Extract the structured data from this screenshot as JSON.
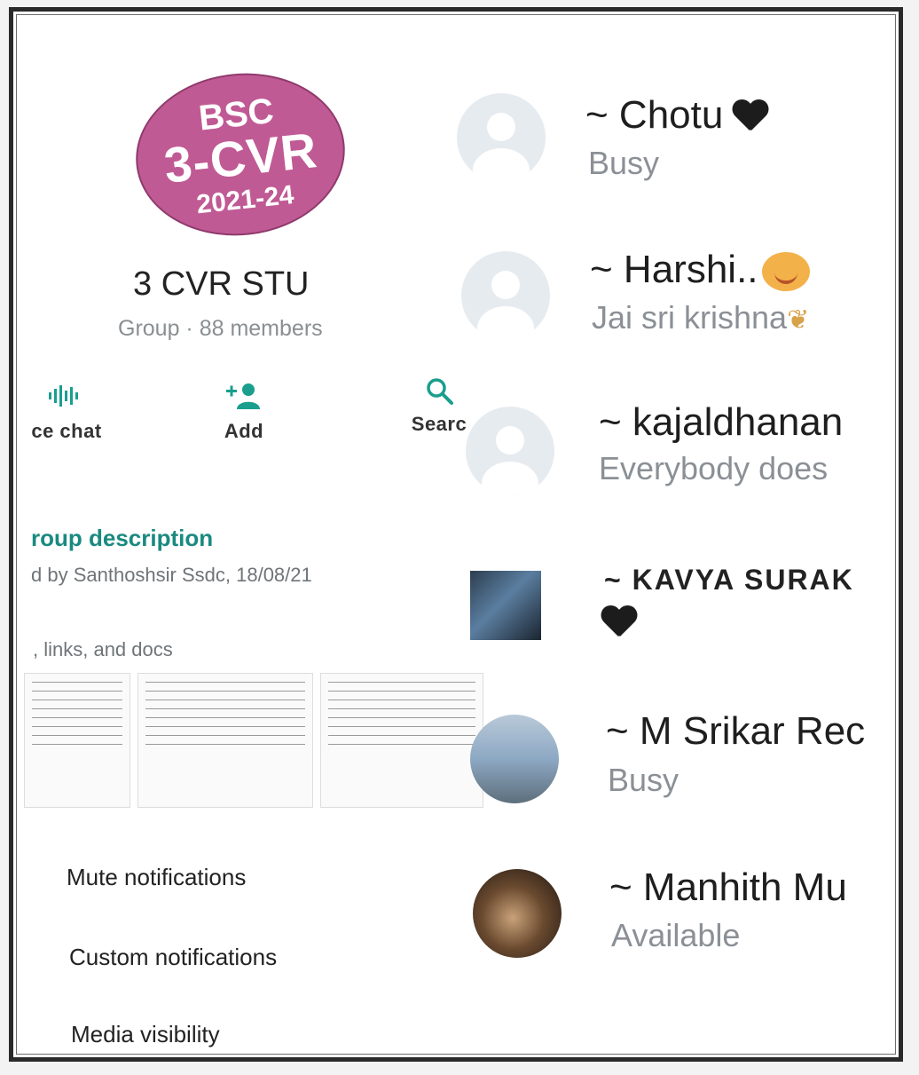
{
  "group": {
    "logo": {
      "line1": "BSC",
      "line2": "3-CVR",
      "line3": "2021-24",
      "color": "#c05a94"
    },
    "name": "3 CVR STU",
    "meta": "Group · 88 members"
  },
  "actions": [
    {
      "label": "ce chat",
      "icon": "voice-chat-icon"
    },
    {
      "label": "Add",
      "icon": "add-person-icon"
    },
    {
      "label": "Searc",
      "icon": "search-icon"
    }
  ],
  "description": {
    "title": "roup description",
    "created_by": "d by Santhoshsir Ssdc, 18/08/21"
  },
  "media": {
    "title": ", links, and docs"
  },
  "settings": [
    {
      "label": "Mute notifications"
    },
    {
      "label": "Custom notifications"
    },
    {
      "label": "Media visibility"
    }
  ],
  "members": [
    {
      "name": "~ Chotu",
      "status": "Busy",
      "emoji": "black-heart-icon"
    },
    {
      "name": "~ Harshi..",
      "status": "Jai sri krishna",
      "emoji": "smiling-face-icon",
      "status_emoji": "folded-hands-icon"
    },
    {
      "name": "~ kajaldhanan",
      "status": "Everybody does"
    },
    {
      "name": "~ KAVYA SURAK",
      "status_emoji": "black-heart-icon"
    },
    {
      "name": "~ M Srikar Rec",
      "status": "Busy"
    },
    {
      "name": "~ Manhith Mu",
      "status": "Available"
    }
  ],
  "colors": {
    "accent": "#1a9e8e",
    "secondary_text": "#8b9096"
  }
}
